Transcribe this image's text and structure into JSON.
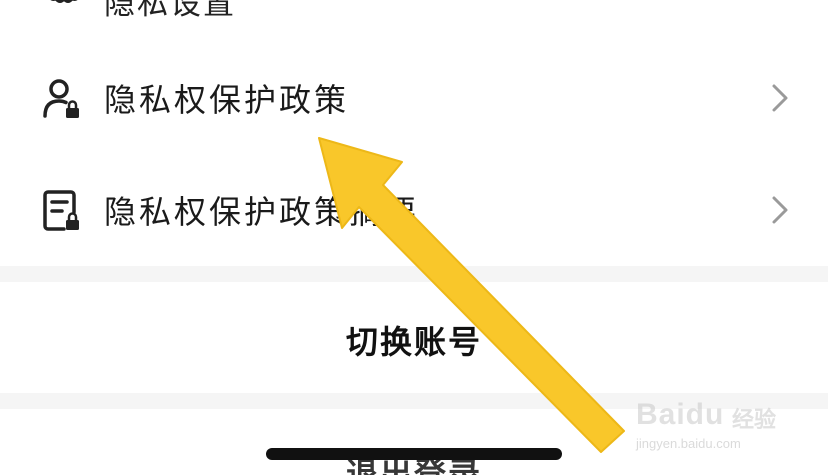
{
  "menu": {
    "partial_top_label": "隐私设置",
    "privacy_policy": {
      "label": "隐私权保护政策",
      "icon": "user-lock-icon"
    },
    "privacy_summary": {
      "label": "隐私权保护政策摘要",
      "icon": "document-lock-icon"
    }
  },
  "actions": {
    "switch_account": "切换账号",
    "logout": "退出登录"
  },
  "watermark": {
    "brand": "Baidu",
    "cn": "经验",
    "url": "jingyen.baidu.com"
  },
  "colors": {
    "arrow": "#F9C72A",
    "band": "#f5f5f5",
    "text": "#1a1a1a"
  }
}
